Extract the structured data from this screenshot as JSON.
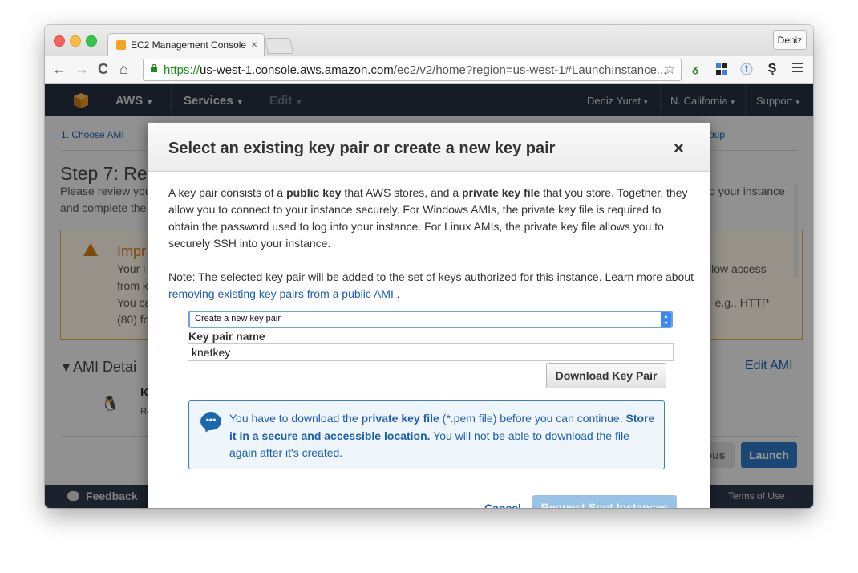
{
  "browser": {
    "tab_title": "EC2 Management Console",
    "tab_close": "×",
    "profile": "Deniz",
    "url_scheme": "https://",
    "url_host": "us-west-1.console.aws.amazon.com",
    "url_path": "/ec2/v2/home?region=us-west-1#LaunchInstance...",
    "nav_back": "←",
    "nav_forward": "→",
    "nav_reload": "C",
    "nav_home": "⌂",
    "star": "☆"
  },
  "awsbar": {
    "aws": "AWS",
    "services": "Services",
    "edit": "Edit",
    "user": "Deniz Yuret",
    "region": "N. California",
    "support": "Support",
    "caret": "▾"
  },
  "background": {
    "wizard_step1": "1. Choose AMI",
    "wizard_right": "oup",
    "step_title": "Step 7: Re",
    "review_line1_left": "Please review you",
    "review_line1_right": "o your instance",
    "review_line2_left": "and complete the",
    "warning_title": "Impr",
    "warn_l1_left": "Your i",
    "warn_l1_right": "llow access",
    "warn_l2_left": "from k",
    "warn_l3_left": "You ca",
    "warn_l3_right": "g, e.g., HTTP",
    "warn_l4_left": "(80) fo",
    "ami_details": "AMI Detai",
    "edit_ami": "Edit AMI",
    "ami_k": "K",
    "ami_r": "Re",
    "previous": "ous",
    "launch": "Launch",
    "feedback": "Feedback",
    "terms": "Terms of Use"
  },
  "modal": {
    "title": "Select an existing key pair or create a new key pair",
    "close": "×",
    "p1_a": "A key pair consists of a ",
    "p1_b": "public key",
    "p1_c": " that AWS stores, and a ",
    "p1_d": "private key file",
    "p1_e": " that you store. Together, they allow you to connect to your instance securely. For Windows AMIs, the private key file is required to obtain the password used to log into your instance. For Linux AMIs, the private key file allows you to securely SSH into your instance.",
    "note_a": "Note: The selected key pair will be added to the set of keys authorized for this instance. Learn more about ",
    "note_link": "removing existing key pairs from a public AMI",
    "note_b": " .",
    "select_value": "Create a new key pair",
    "key_pair_label": "Key pair name",
    "key_pair_value": "knetkey",
    "download_button": "Download Key Pair",
    "info_a": "You have to download the ",
    "info_b": "private key file",
    "info_c": " (*.pem file) before you can continue. ",
    "info_d": "Store it in a secure and accessible location.",
    "info_e": " You will not be able to download the file again after it's created.",
    "cancel": "Cancel",
    "request_spot": "Request Spot Instances"
  },
  "colors": {
    "aws_bar": "#232f3e",
    "link_blue": "#1a5fb4",
    "warning_orange": "#d87c0f",
    "launch_blue": "#2f77c2"
  }
}
